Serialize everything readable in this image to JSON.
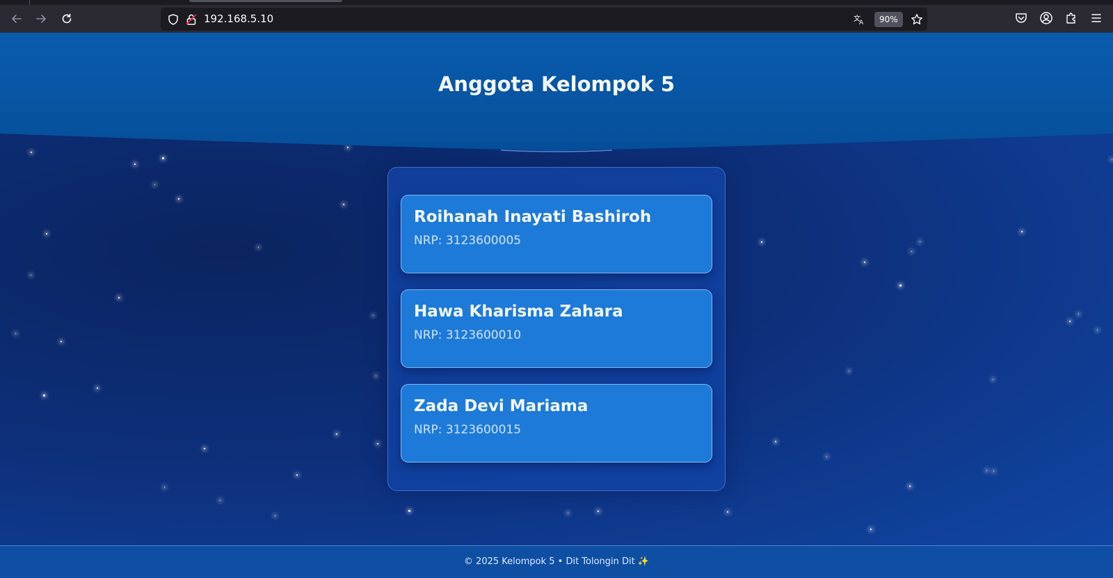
{
  "browser": {
    "url": "192.168.5.10",
    "zoom": "90%",
    "icons": [
      "back-arrow-icon",
      "forward-arrow-icon",
      "reload-icon",
      "shield-icon",
      "insecure-lock-icon",
      "translate-icon",
      "bookmark-star-icon",
      "pocket-icon",
      "account-icon",
      "extensions-icon",
      "menu-icon"
    ]
  },
  "page": {
    "title": "Anggota Kelompok 5",
    "members": [
      {
        "name": "Roihanah Inayati Bashiroh",
        "nrp": "NRP: 3123600005"
      },
      {
        "name": "Hawa Kharisma Zahara",
        "nrp": "NRP: 3123600010"
      },
      {
        "name": "Zada Devi Mariama",
        "nrp": "NRP: 3123600015"
      }
    ],
    "footer": "© 2025 Kelompok 5 • Dit Tolongin Dit ✨"
  },
  "colors": {
    "header": "#0a5cae",
    "background": "#0d2f7a",
    "card": "#1e7ad8",
    "footer": "#0f4fa3"
  }
}
